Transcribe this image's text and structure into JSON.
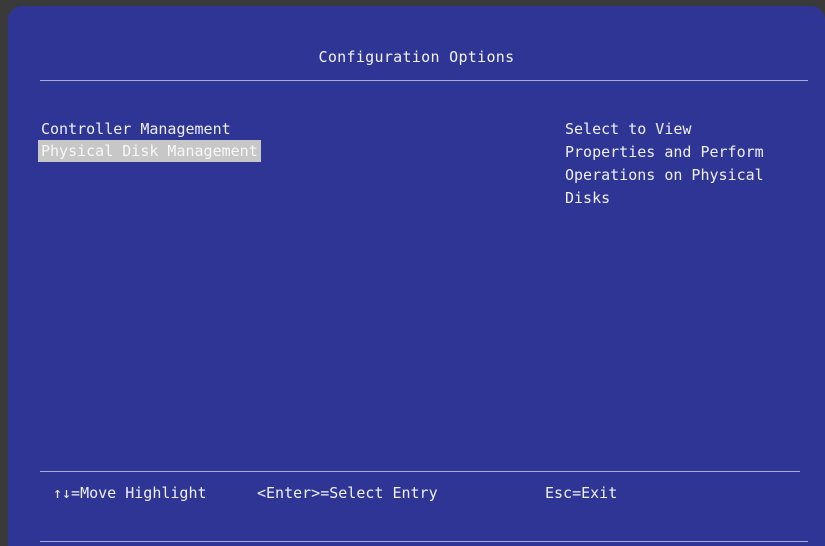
{
  "screen": {
    "title": "Configuration Options"
  },
  "menu": {
    "items": [
      {
        "label": "Controller Management",
        "selected": false
      },
      {
        "label": "Physical Disk Management",
        "selected": true
      }
    ]
  },
  "help": {
    "text": "Select to View\nProperties and Perform\nOperations on Physical\nDisks"
  },
  "footer": {
    "move_hint": "↑↓=Move Highlight",
    "enter_hint": "<Enter>=Select Entry",
    "exit_hint": "Esc=Exit"
  },
  "colors": {
    "background": "#2f3594",
    "text": "#eef0f6",
    "highlight": "#c7c7c7"
  }
}
